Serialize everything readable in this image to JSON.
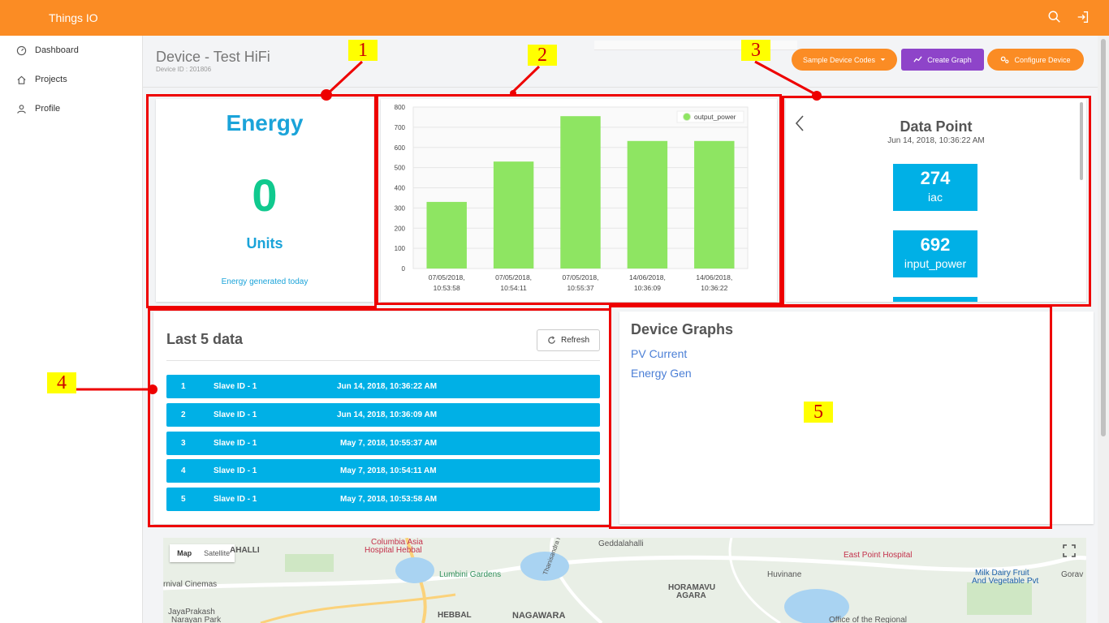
{
  "app": {
    "brand": "Things IO"
  },
  "sidebar": {
    "items": [
      {
        "label": "Dashboard"
      },
      {
        "label": "Projects"
      },
      {
        "label": "Profile"
      }
    ]
  },
  "header": {
    "title": "Device - Test HiFi",
    "device_id": "Device ID : 201806",
    "buttons": {
      "sample_codes": "Sample Device Codes",
      "create_graph": "Create Graph",
      "configure_device": "Configure Device"
    }
  },
  "annotations": [
    "1",
    "2",
    "3",
    "4",
    "5"
  ],
  "energy": {
    "title": "Energy",
    "value": "0",
    "unit": "Units",
    "note": "Energy generated today"
  },
  "chart_data": {
    "type": "bar",
    "categories": [
      "07/05/2018, 10:53:58",
      "07/05/2018, 10:54:11",
      "07/05/2018, 10:55:37",
      "14/06/2018, 10:36:09",
      "14/06/2018, 10:36:22"
    ],
    "series": [
      {
        "name": "output_power",
        "values": [
          330,
          530,
          755,
          632,
          632
        ],
        "color": "#8ee562"
      }
    ],
    "ylim": [
      0,
      800
    ],
    "yticks": [
      0,
      100,
      200,
      300,
      400,
      500,
      600,
      700,
      800
    ],
    "grid": true,
    "legend": "top-right"
  },
  "datapoint": {
    "title": "Data Point",
    "date": "Jun 14, 2018, 10:36:22 AM",
    "tiles": [
      {
        "value": "274",
        "label": "iac"
      },
      {
        "value": "692",
        "label": "input_power"
      }
    ]
  },
  "last5": {
    "title": "Last 5 data",
    "refresh": "Refresh",
    "rows": [
      {
        "n": "1",
        "slave": "Slave ID - 1",
        "time": "Jun 14, 2018, 10:36:22 AM"
      },
      {
        "n": "2",
        "slave": "Slave ID - 1",
        "time": "Jun 14, 2018, 10:36:09 AM"
      },
      {
        "n": "3",
        "slave": "Slave ID - 1",
        "time": "May 7, 2018, 10:55:37 AM"
      },
      {
        "n": "4",
        "slave": "Slave ID - 1",
        "time": "May 7, 2018, 10:54:11 AM"
      },
      {
        "n": "5",
        "slave": "Slave ID - 1",
        "time": "May 7, 2018, 10:53:58 AM"
      }
    ]
  },
  "graphs": {
    "title": "Device Graphs",
    "links": [
      "PV Current",
      "Energy Gen"
    ]
  },
  "map": {
    "tabs": [
      "Map",
      "Satellite"
    ],
    "labels": [
      "AHALLI",
      "Columbia Asia",
      "Hospital Hebbal",
      "Geddalahalli",
      "East Point Hospital",
      "Lumbini Gardens",
      "rnival Cinemas",
      "JayaPrakash",
      "Narayan Park",
      "HEBBAL",
      "NAGAWARA",
      "HORAMAVU",
      "AGARA",
      "Huvinane",
      "Milk Dairy Fruit",
      "And Vegetable Pvt",
      "Gorav",
      "Office of the Regional",
      "Thanisandra Main Rd"
    ]
  },
  "colors": {
    "orange": "#fb8c24",
    "purple": "#8e44c9",
    "blue": "#00b0e6",
    "red_annotation": "#ee0000"
  }
}
